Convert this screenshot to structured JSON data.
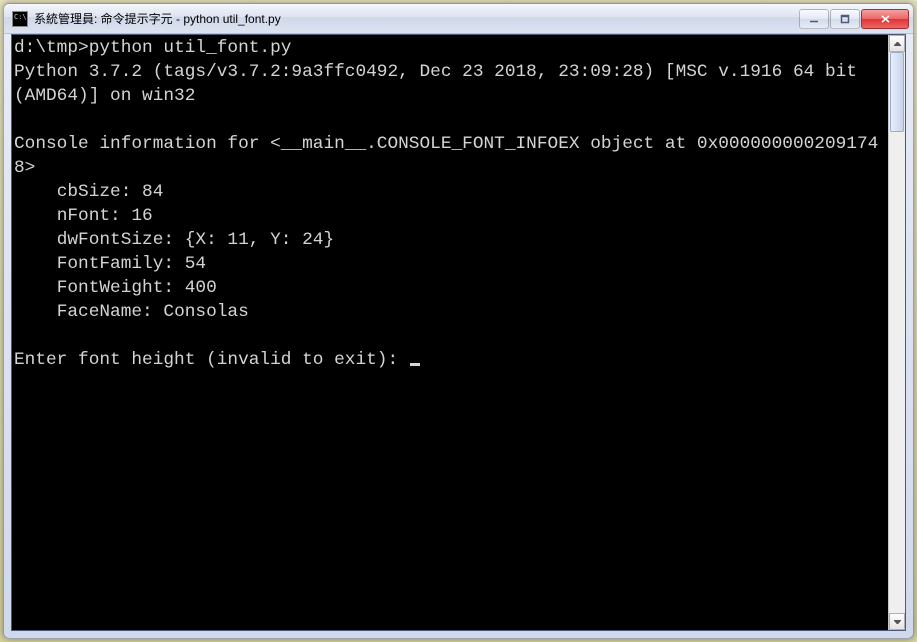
{
  "window": {
    "title": "系統管理員: 命令提示字元 - python  util_font.py"
  },
  "console": {
    "prompt": "d:\\tmp>",
    "command": "python util_font.py",
    "version_line": "Python 3.7.2 (tags/v3.7.2:9a3ffc0492, Dec 23 2018, 23:09:28) [MSC v.1916 64 bit (AMD64)] on win32",
    "info_header": "Console information for <__main__.CONSOLE_FONT_INFOEX object at 0x0000000002091748>",
    "fields": {
      "cbSize": "cbSize: 84",
      "nFont": "nFont: 16",
      "dwFontSize": "dwFontSize: {X: 11, Y: 24}",
      "FontFamily": "FontFamily: 54",
      "FontWeight": "FontWeight: 400",
      "FaceName": "FaceName: Consolas"
    },
    "input_prompt": "Enter font height (invalid to exit): "
  }
}
